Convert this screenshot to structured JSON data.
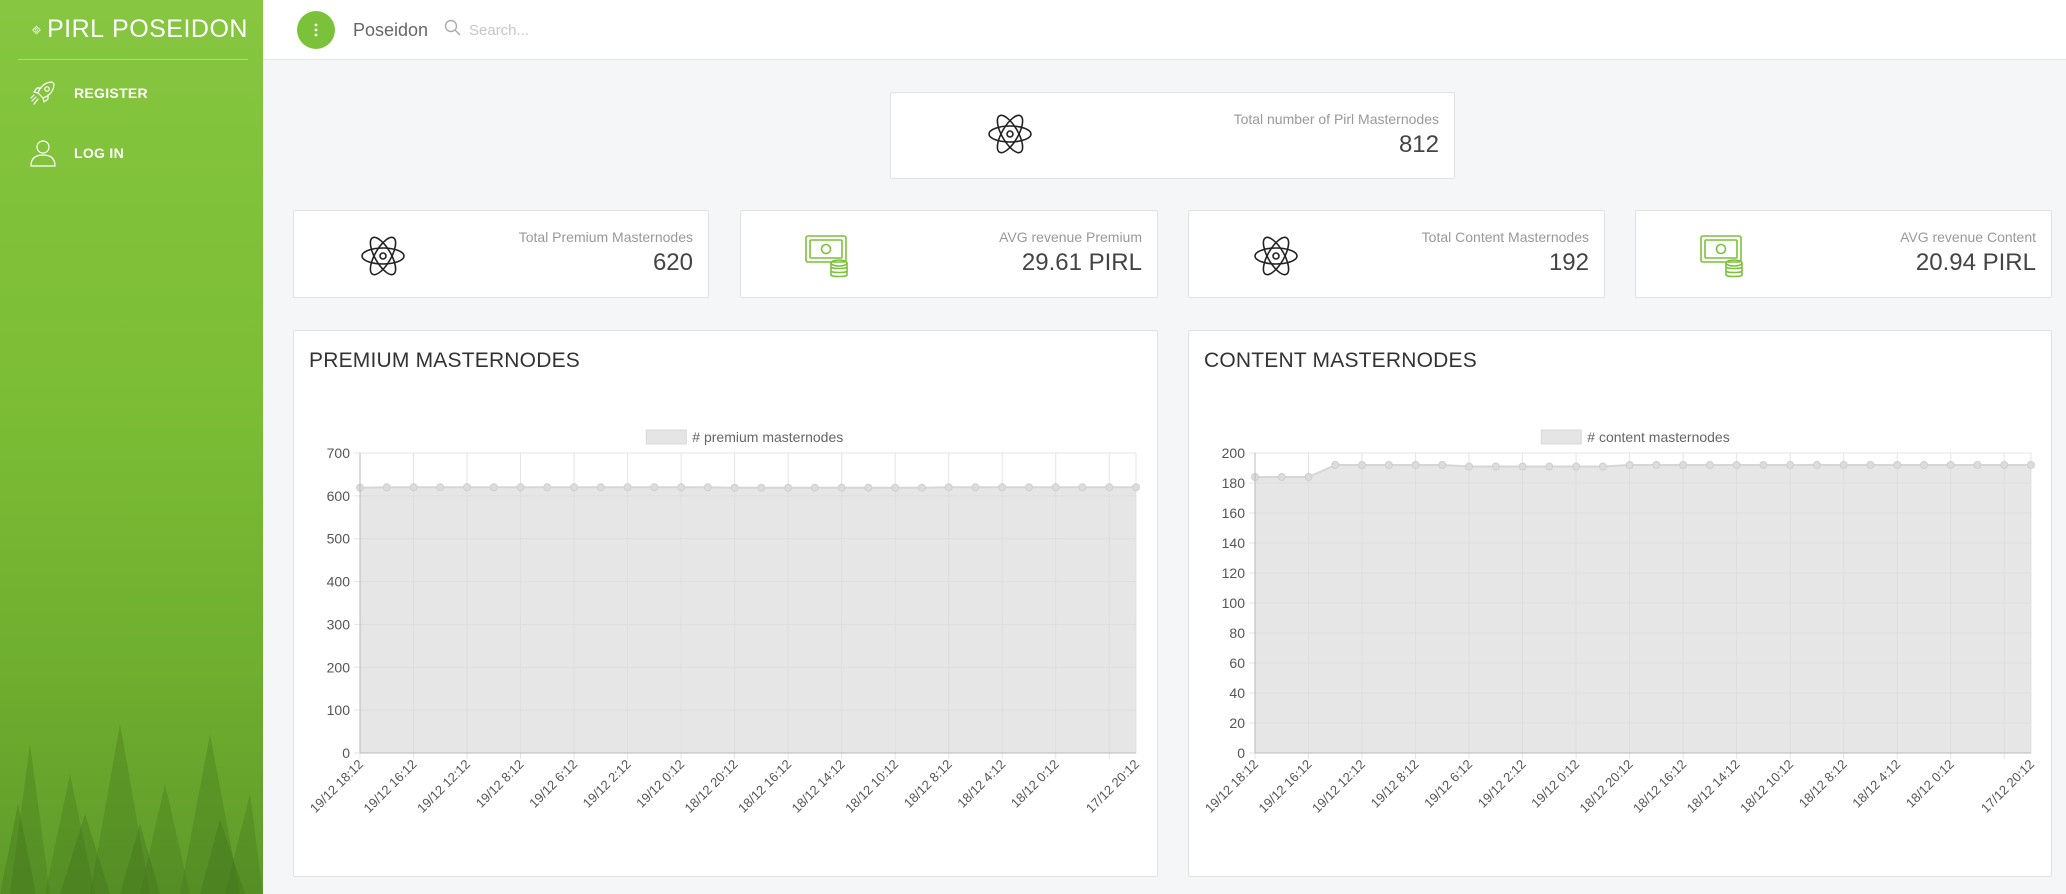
{
  "sidebar": {
    "brand_light": "PIRL",
    "brand_bold": "POSEIDON",
    "items": [
      {
        "label": "REGISTER",
        "icon": "rocket-icon"
      },
      {
        "label": "LOG IN",
        "icon": "user-icon"
      }
    ]
  },
  "topbar": {
    "menu_icon": "dots-vertical-icon",
    "title": "Poseidon",
    "search_placeholder": "Search..."
  },
  "stats": {
    "total": {
      "label": "Total number of Pirl Masternodes",
      "value": "812",
      "icon": "atom-icon"
    },
    "premium": {
      "label": "Total Premium Masternodes",
      "value": "620",
      "icon": "atom-icon"
    },
    "avg_premium": {
      "label": "AVG revenue Premium",
      "value": "29.61 PIRL",
      "icon": "money-coins-icon"
    },
    "content": {
      "label": "Total Content Masternodes",
      "value": "192",
      "icon": "atom-icon"
    },
    "avg_content": {
      "label": "AVG revenue Content",
      "value": "20.94 PIRL",
      "icon": "money-coins-icon"
    }
  },
  "colors": {
    "accent": "#7cc13a",
    "area_fill": "#e5e5e5",
    "area_line": "#d8d8d8"
  },
  "chart_data": [
    {
      "type": "area",
      "title": "PREMIUM MASTERNODES",
      "legend": "# premium masternodes",
      "legend_position": "top-center",
      "grid": true,
      "ylim": [
        0,
        700
      ],
      "yticks": [
        0,
        100,
        200,
        300,
        400,
        500,
        600,
        700
      ],
      "xtick_labels": [
        "19/12 18:12",
        "19/12 16:12",
        "19/12 12:12",
        "19/12 8:12",
        "19/12 6:12",
        "19/12 2:12",
        "19/12 0:12",
        "18/12 20:12",
        "18/12 16:12",
        "18/12 14:12",
        "18/12 10:12",
        "18/12 8:12",
        "18/12 4:12",
        "18/12 0:12",
        "17/12 20:12"
      ],
      "series": [
        {
          "name": "# premium masternodes",
          "values": [
            619,
            620,
            620,
            620,
            620,
            620,
            620,
            620,
            620,
            620,
            620,
            620,
            620,
            620,
            619,
            619,
            619,
            619,
            619,
            619,
            619,
            619,
            620,
            620,
            620,
            620,
            620,
            620,
            620,
            620
          ]
        }
      ]
    },
    {
      "type": "area",
      "title": "CONTENT MASTERNODES",
      "legend": "# content masternodes",
      "legend_position": "top-center",
      "grid": true,
      "ylim": [
        0,
        200
      ],
      "yticks": [
        0,
        20,
        40,
        60,
        80,
        100,
        120,
        140,
        160,
        180,
        200
      ],
      "xtick_labels": [
        "19/12 18:12",
        "19/12 16:12",
        "19/12 12:12",
        "19/12 8:12",
        "19/12 6:12",
        "19/12 2:12",
        "19/12 0:12",
        "18/12 20:12",
        "18/12 16:12",
        "18/12 14:12",
        "18/12 10:12",
        "18/12 8:12",
        "18/12 4:12",
        "18/12 0:12",
        "17/12 20:12"
      ],
      "series": [
        {
          "name": "# content masternodes",
          "values": [
            184,
            184,
            184,
            192,
            192,
            192,
            192,
            192,
            191,
            191,
            191,
            191,
            191,
            191,
            192,
            192,
            192,
            192,
            192,
            192,
            192,
            192,
            192,
            192,
            192,
            192,
            192,
            192,
            192,
            192
          ]
        }
      ]
    }
  ]
}
